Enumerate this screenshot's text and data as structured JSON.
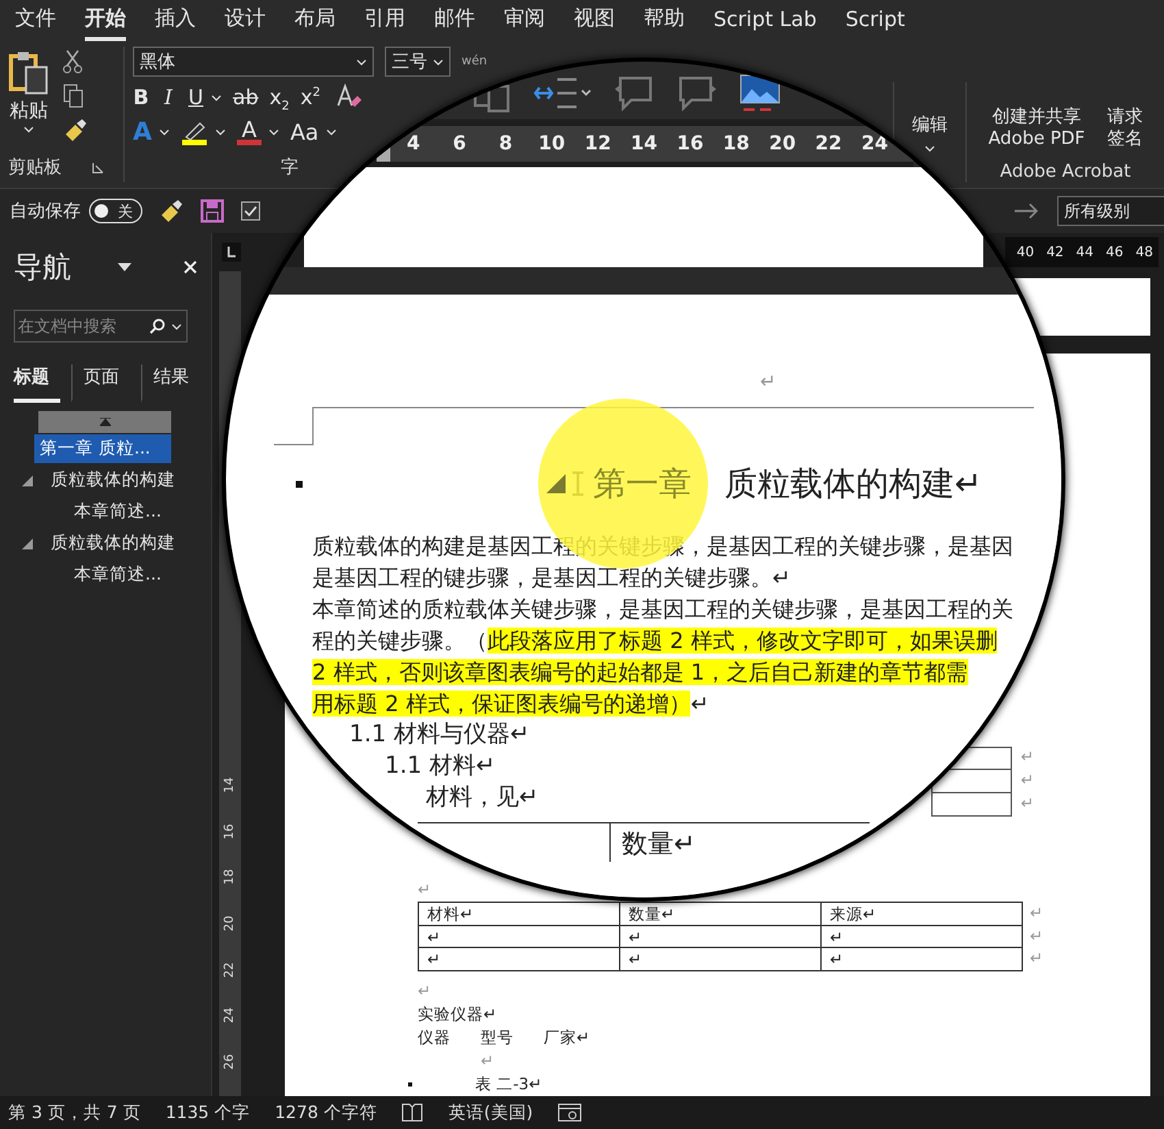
{
  "menu_tabs": [
    {
      "label": "文件",
      "selected": false
    },
    {
      "label": "开始",
      "selected": true
    },
    {
      "label": "插入",
      "selected": false
    },
    {
      "label": "设计",
      "selected": false
    },
    {
      "label": "布局",
      "selected": false
    },
    {
      "label": "引用",
      "selected": false
    },
    {
      "label": "邮件",
      "selected": false
    },
    {
      "label": "审阅",
      "selected": false
    },
    {
      "label": "视图",
      "selected": false
    },
    {
      "label": "帮助",
      "selected": false
    },
    {
      "label": "Script Lab",
      "selected": false
    },
    {
      "label": "Script",
      "selected": false
    }
  ],
  "ribbon": {
    "clipboard": {
      "paste_label": "粘贴",
      "group_label": "剪贴板"
    },
    "font": {
      "font_name": "黑体",
      "font_size": "三号",
      "phonetic": "wén",
      "group_label": "字",
      "format_buttons": [
        {
          "kind": "bold",
          "text": "B",
          "dropdown": false
        },
        {
          "kind": "italic",
          "text": "I",
          "dropdown": false
        },
        {
          "kind": "underline",
          "text": "U",
          "dropdown": true
        },
        {
          "kind": "strike",
          "text": "ab",
          "dropdown": false
        },
        {
          "kind": "subscript",
          "text": "x$_{2}$",
          "dropdown": false
        },
        {
          "kind": "superscript",
          "text": "x$^{2}$",
          "dropdown": false
        }
      ],
      "color_buttons": [
        {
          "kind": "effects",
          "text": "A",
          "color": "#2f7fd6",
          "dropdown": true
        },
        {
          "kind": "highlight",
          "color": "#ffff00",
          "dropdown": true
        },
        {
          "kind": "font_color",
          "text": "A",
          "color": "#d13438",
          "dropdown": true
        },
        {
          "kind": "case",
          "text": "Aa",
          "dropdown": true
        }
      ]
    },
    "editing": {
      "label": "编辑"
    },
    "acrobat": {
      "create_lines": [
        "创建并共享",
        "Adobe PDF"
      ],
      "sign_lines": [
        "请求",
        "签名"
      ],
      "group_label": "Adobe Acrobat"
    }
  },
  "quick_access": {
    "autosave_label": "自动保存",
    "autosave_on": false,
    "autosave_state": "关",
    "checkbox_checked": true
  },
  "outline_level": "所有级别",
  "navigation": {
    "title": "导航",
    "search_placeholder": "在文档中搜索",
    "tabs": [
      {
        "label": "标题",
        "selected": true
      },
      {
        "label": "页面",
        "selected": false
      },
      {
        "label": "结果",
        "selected": false
      }
    ],
    "headings": [
      {
        "text": "第一章 质粒...",
        "selected": true
      },
      {
        "text": "质粒载体的构建",
        "selected": false,
        "expanded": true,
        "children": [
          {
            "text": "本章简述...",
            "selected": false
          }
        ]
      },
      {
        "text": "质粒载体的构建",
        "selected": false,
        "expanded": true,
        "children": [
          {
            "text": "本章简述...",
            "selected": false
          }
        ]
      }
    ]
  },
  "ruler": {
    "top_ticks": [
      "4",
      "6",
      "8",
      "10",
      "12",
      "14",
      "16",
      "18",
      "20",
      "22",
      "24"
    ],
    "right_ticks": [
      "40",
      "42",
      "44",
      "46",
      "48"
    ],
    "side_ticks": [
      "14",
      "16",
      "18",
      "20",
      "22",
      "24",
      "26"
    ]
  },
  "magnified": {
    "header_mark": "↵",
    "heading": {
      "number": "第一章",
      "title": "质粒载体的构建↵",
      "expanded": true
    },
    "lines": [
      {
        "segments": [
          {
            "text": "质粒载体的构建是基因工程的关键步骤，是基因工程的关键步骤，是基因",
            "highlighted": false
          }
        ]
      },
      {
        "segments": [
          {
            "text": "是基因工程的键步骤，是基因工程的关键步骤。↵",
            "highlighted": false
          }
        ]
      },
      {
        "segments": [
          {
            "text": "本章简述的质粒载体关键步骤，是基因工程的关键步骤，是基因工程的关",
            "highlighted": false
          }
        ]
      },
      {
        "segments": [
          {
            "text": "程的关键步骤。（",
            "highlighted": false
          },
          {
            "text": "此段落应用了标题 2 样式，修改文字即可，如果误删",
            "highlighted": true
          }
        ]
      },
      {
        "segments": [
          {
            "text": "2 样式，否则该章图表编号的起始都是 1，之后自己新建的章节都需",
            "highlighted": true
          }
        ]
      },
      {
        "segments": [
          {
            "text": "用标题 2 样式，保证图表编号的递增）",
            "highlighted": true
          },
          {
            "text": "↵",
            "highlighted": false
          }
        ]
      }
    ],
    "subheadings": [
      "1.1  材料与仪器↵",
      "1.1  材料↵",
      "材料，见↵"
    ],
    "table_cell": "数量↵"
  },
  "document": {
    "fragment_marks": [
      "↵",
      "↵",
      "↵"
    ],
    "before_table": "↵",
    "table": {
      "rows": [
        [
          "材料↵",
          "数量↵",
          "来源↵"
        ],
        [
          "↵",
          "↵",
          "↵"
        ],
        [
          "↵",
          "↵",
          "↵"
        ]
      ],
      "row_marks": [
        "↵",
        "↵",
        "↵"
      ]
    },
    "after_table": "↵",
    "instruments_title": "实验仪器↵",
    "instrument_columns": [
      "仪器",
      "型号",
      "厂家↵"
    ],
    "blank_line": "↵",
    "caption": "表 二-3↵"
  },
  "status_bar": {
    "page": "第 3 页，共 7 页",
    "words": "1135 个字",
    "chars": "1278 个字符",
    "language": "英语(美国)"
  }
}
